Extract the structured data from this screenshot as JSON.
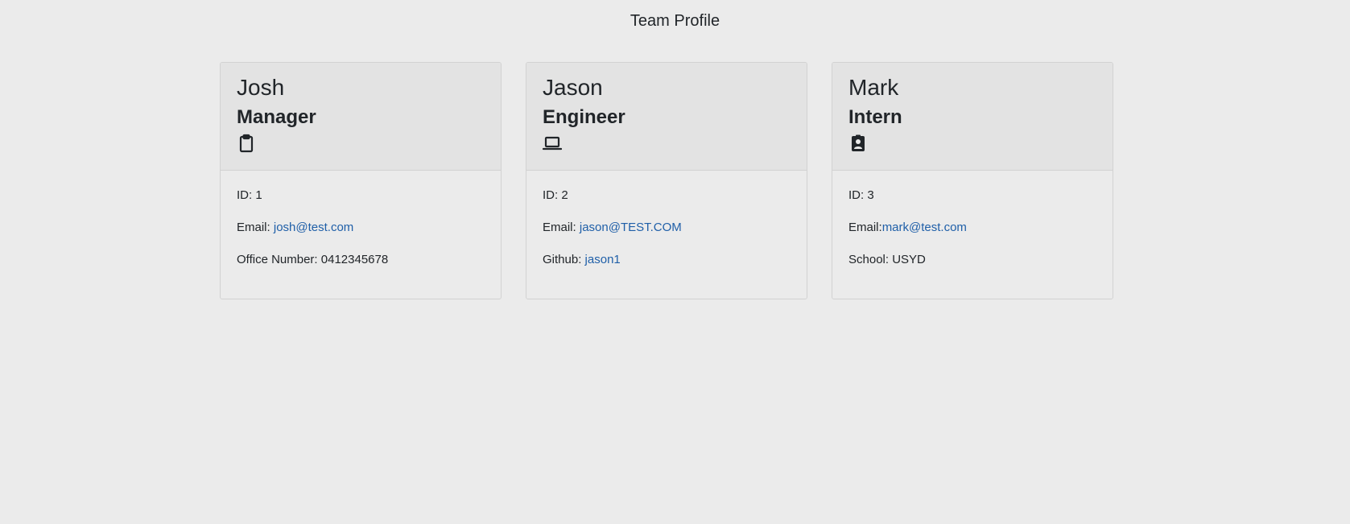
{
  "page": {
    "title": "Team Profile"
  },
  "team": [
    {
      "name": "Josh",
      "role": "Manager",
      "icon": "clipboard-icon",
      "id_label": "ID:",
      "id": "1",
      "email_label": "Email:",
      "email": "josh@test.com",
      "extra_label": "Office Number:",
      "extra_value": "0412345678"
    },
    {
      "name": "Jason",
      "role": "Engineer",
      "icon": "laptop-icon",
      "id_label": "ID:",
      "id": "2",
      "email_label": "Email:",
      "email": "jason@TEST.COM",
      "extra_label": "Github:",
      "extra_value": "jason1"
    },
    {
      "name": "Mark",
      "role": "Intern",
      "icon": "student-id-icon",
      "id_label": "ID:",
      "id": "3",
      "email_label": "Email:",
      "email": "mark@test.com",
      "extra_label": "School:",
      "extra_value": "USYD"
    }
  ],
  "colors": {
    "background": "#ebebeb",
    "card_header": "#e3e3e3",
    "link": "#1f5fa8",
    "text": "#212529"
  }
}
